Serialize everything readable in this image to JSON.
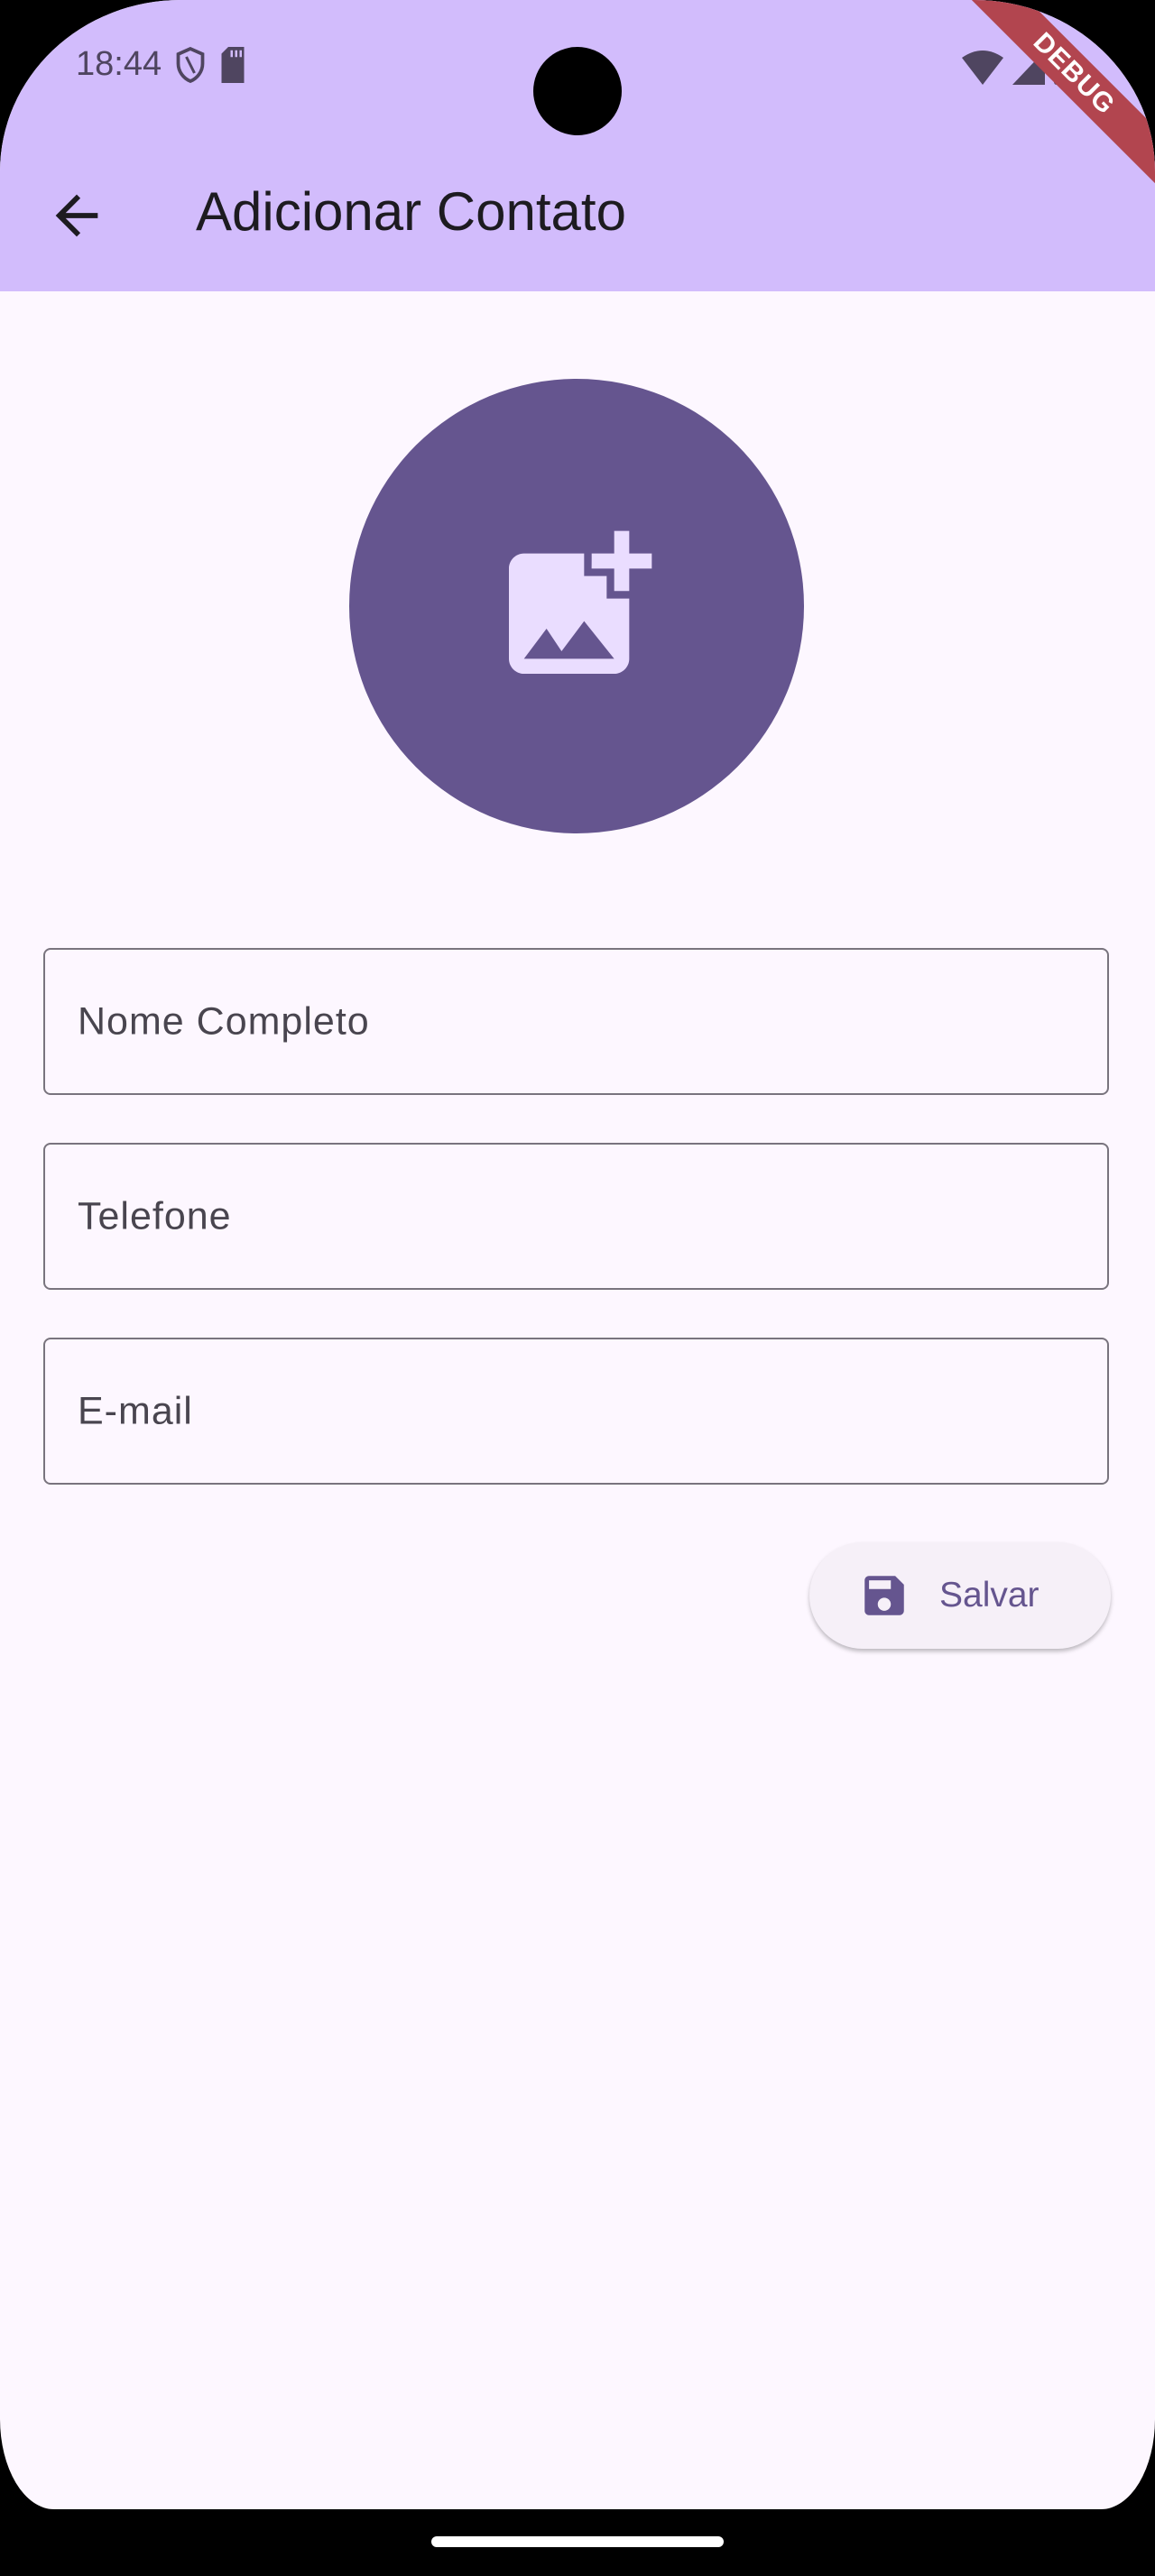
{
  "status_bar": {
    "time": "18:44",
    "icons": [
      "shield-icon",
      "sd-card-icon",
      "wifi-icon",
      "signal-icon",
      "battery-icon"
    ]
  },
  "debug_banner": "DEBUG",
  "app_bar": {
    "title": "Adicionar Contato",
    "back_icon": "arrow-back-icon"
  },
  "avatar": {
    "icon": "add-photo-icon"
  },
  "form": {
    "fields": [
      {
        "label": "Nome Completo",
        "value": ""
      },
      {
        "label": "Telefone",
        "value": ""
      },
      {
        "label": "E-mail",
        "value": ""
      }
    ],
    "save_label": "Salvar"
  },
  "colors": {
    "primary": "#65558f",
    "app_bar": "#d2bcfc",
    "background": "#fdf7ff"
  }
}
